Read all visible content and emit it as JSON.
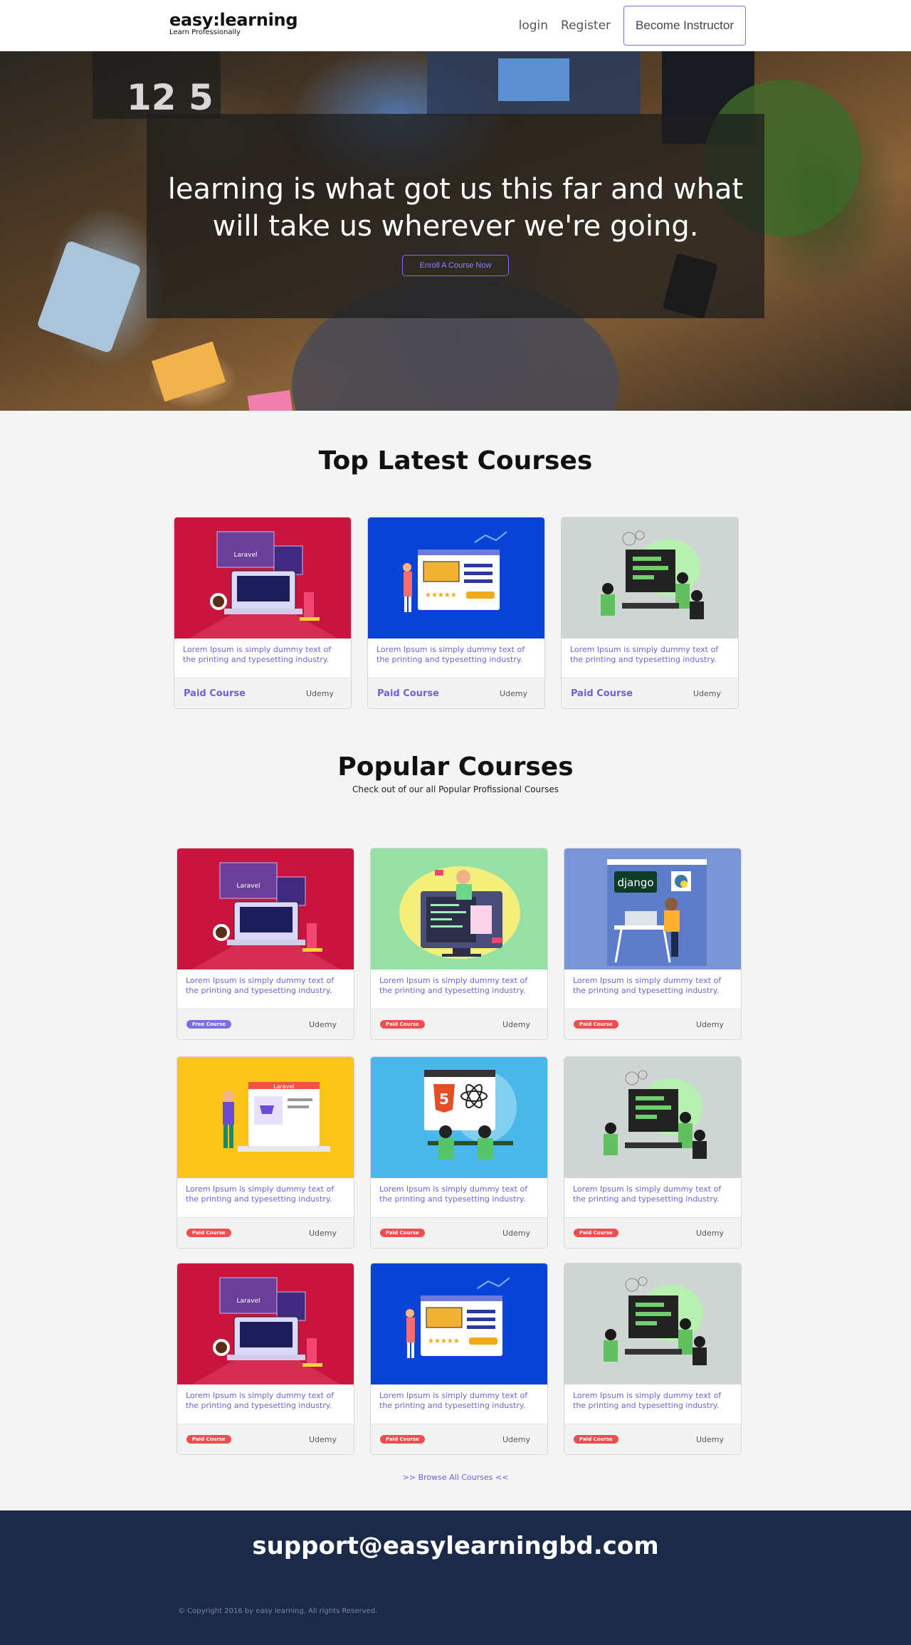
{
  "nav": {
    "logo_main": "easy:learning",
    "logo_sub": "Learn Professionally",
    "login": "login",
    "register": "Register",
    "become_instructor": "Become Instructor"
  },
  "hero": {
    "title_line1": "learning is what got us this far and what",
    "title_line2": "will take us wherever we're going.",
    "button": "Enroll A Course Now"
  },
  "latest": {
    "title": "Top Latest Courses",
    "cards": [
      {
        "illustration": "laravel-laptop-red",
        "text1": "Lorem Ipsum is simply dummy text of",
        "text2": "the printing and typesetting industry.",
        "tag": "Paid Course",
        "provider": "Udemy"
      },
      {
        "illustration": "adsense-blue",
        "text1": "Lorem Ipsum is simply dummy text of",
        "text2": "the printing and typesetting industry.",
        "tag": "Paid Course",
        "provider": "Udemy"
      },
      {
        "illustration": "team-meeting-gray",
        "text1": "Lorem Ipsum is simply dummy text of",
        "text2": "the printing and typesetting industry.",
        "tag": "Paid Course",
        "provider": "Udemy"
      }
    ]
  },
  "popular": {
    "title": "Popular Courses",
    "subtitle": "Check out of our all Popular Profissional Courses",
    "cards": [
      {
        "illustration": "laravel-laptop-red",
        "text1": "Lorem Ipsum is simply dummy text of",
        "text2": "the printing and typesetting industry.",
        "tag": "Free Course",
        "provider": "Udemy"
      },
      {
        "illustration": "developer-green",
        "text1": "Lorem Ipsum is simply dummy text of",
        "text2": "the printing and typesetting industry.",
        "tag": "Paid Course",
        "provider": "Udemy"
      },
      {
        "illustration": "django-purple",
        "text1": "Lorem Ipsum is simply dummy text of",
        "text2": "the printing and typesetting industry.",
        "tag": "Paid Course",
        "provider": "Udemy"
      },
      {
        "illustration": "laravel-shop-yellow",
        "text1": "Lorem Ipsum is simply dummy text of",
        "text2": "the printing and typesetting industry.",
        "tag": "Paid Course",
        "provider": "Udemy"
      },
      {
        "illustration": "html5-react-cyan",
        "text1": "Lorem Ipsum is simply dummy text of",
        "text2": "the printing and typesetting industry.",
        "tag": "Paid Course",
        "provider": "Udemy"
      },
      {
        "illustration": "team-meeting-gray",
        "text1": "Lorem Ipsum is simply dummy text of",
        "text2": "the printing and typesetting industry.",
        "tag": "Paid Course",
        "provider": "Udemy"
      },
      {
        "illustration": "laravel-laptop-red",
        "text1": "Lorem Ipsum is simply dummy text of",
        "text2": "the printing and typesetting industry.",
        "tag": "Paid Course",
        "provider": "Udemy"
      },
      {
        "illustration": "adsense-blue",
        "text1": "Lorem Ipsum is simply dummy text of",
        "text2": "the printing and typesetting industry.",
        "tag": "Paid Course",
        "provider": "Udemy"
      },
      {
        "illustration": "team-meeting-gray",
        "text1": "Lorem Ipsum is simply dummy text of",
        "text2": "the printing and typesetting industry.",
        "tag": "Paid Course",
        "provider": "Udemy"
      }
    ],
    "browse_all": ">> Browse All Courses <<"
  },
  "footer": {
    "email": "support@easylearningbd.com",
    "copyright": "© Copyright 2016 by easy learning. All rights Reserved."
  },
  "colors": {
    "accent": "#7c6fe3",
    "paid_pill": "#ef4e4e",
    "footer_bg": "#1c2a4a",
    "laravel_red": "#c8143f",
    "adsense_blue": "#0a43d8",
    "meeting_gray": "#cfd5d3",
    "developer_green": "#96e0a6",
    "django_purple": "#7b96d8",
    "laravel_yellow": "#fcc419",
    "react_cyan": "#4ab8ea"
  }
}
